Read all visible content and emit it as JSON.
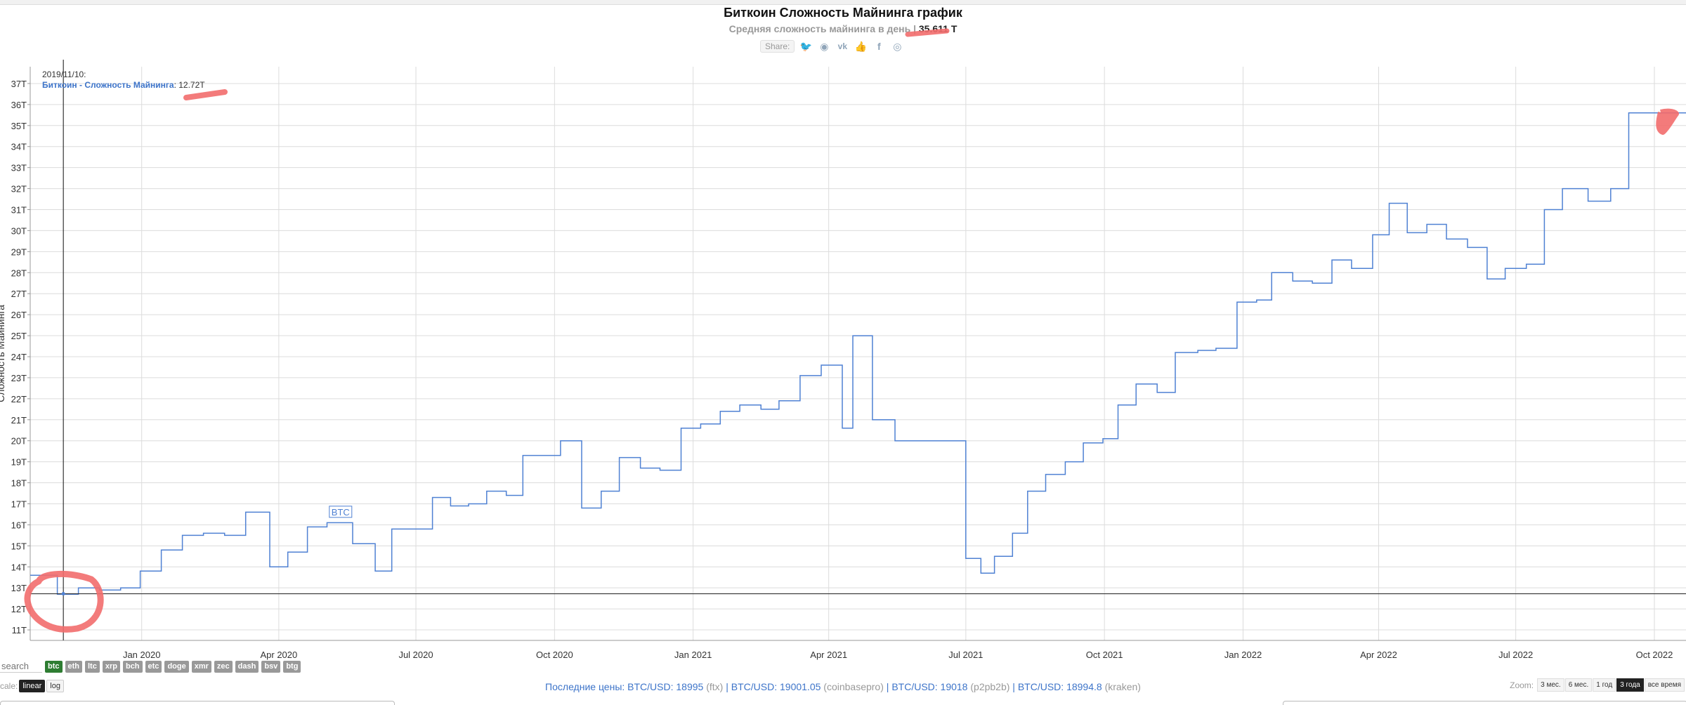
{
  "title": "Биткоин Сложность Майнинга график",
  "subtitle": {
    "label": "Средняя сложность майнинга в день | ",
    "value": "35.611 T"
  },
  "share": {
    "label": "Share:",
    "icons": [
      "twitter-icon",
      "reddit-icon",
      "vk-icon",
      "like-icon",
      "facebook-icon",
      "weibo-icon"
    ]
  },
  "tooltip": {
    "date": "2019/11/10:",
    "series": "Биткоин - Сложность Майнинга",
    "value": "12.72T"
  },
  "flag_label": "BTC",
  "coins": [
    "btc",
    "eth",
    "ltc",
    "xrp",
    "bch",
    "etc",
    "doge",
    "xmr",
    "zec",
    "dash",
    "bsv",
    "btg"
  ],
  "active_coin": "btc",
  "search_placeholder": "search",
  "scale": {
    "label": "cale:",
    "options": [
      "linear",
      "log"
    ],
    "active": "linear"
  },
  "prices": {
    "label": "Последние цены:",
    "items": [
      {
        "pair": "BTC/USD",
        "price": "18995",
        "exchange": "(ftx)"
      },
      {
        "pair": "BTC/USD",
        "price": "19001.05",
        "exchange": "(coinbasepro)"
      },
      {
        "pair": "BTC/USD",
        "price": "19018",
        "exchange": "(p2pb2b)"
      },
      {
        "pair": "BTC/USD",
        "price": "18994.8",
        "exchange": "(kraken)"
      }
    ]
  },
  "zoom": {
    "label": "Zoom:",
    "options": [
      "3 мес.",
      "6 мес.",
      "1 год",
      "3 года",
      "все время"
    ],
    "active": "3 года"
  },
  "colors": {
    "line": "#4f81d3",
    "grid": "#dcdcdc",
    "annotation": "#f26d6d",
    "axis": "#333333"
  },
  "chart_data": {
    "type": "line",
    "title": "Биткоин Сложность Майнинга график",
    "ylabel": "Сложность Майнинга",
    "y_unit": "T",
    "ylim": [
      10.5,
      37.8
    ],
    "xlim": [
      "2019-10-19",
      "2022-10-22"
    ],
    "y_ticks": [
      11,
      12,
      13,
      14,
      15,
      16,
      17,
      18,
      19,
      20,
      21,
      22,
      23,
      24,
      25,
      26,
      27,
      28,
      29,
      30,
      31,
      32,
      33,
      34,
      35,
      36,
      37
    ],
    "x_ticks": [
      {
        "date": "2020-01-01",
        "label": "Jan 2020"
      },
      {
        "date": "2020-04-01",
        "label": "Apr 2020"
      },
      {
        "date": "2020-07-01",
        "label": "Jul 2020"
      },
      {
        "date": "2020-10-01",
        "label": "Oct 2020"
      },
      {
        "date": "2021-01-01",
        "label": "Jan 2021"
      },
      {
        "date": "2021-04-01",
        "label": "Apr 2021"
      },
      {
        "date": "2021-07-01",
        "label": "Jul 2021"
      },
      {
        "date": "2021-10-01",
        "label": "Oct 2021"
      },
      {
        "date": "2022-01-01",
        "label": "Jan 2022"
      },
      {
        "date": "2022-04-01",
        "label": "Apr 2022"
      },
      {
        "date": "2022-07-01",
        "label": "Jul 2022"
      },
      {
        "date": "2022-10-01",
        "label": "Oct 2022"
      }
    ],
    "grid": true,
    "crosshair": {
      "date": "2019-11-10",
      "value": 12.72
    },
    "series": [
      {
        "name": "Биткоин - Сложность Майнинга",
        "points": [
          [
            "2019-10-19",
            13.6
          ],
          [
            "2019-11-03",
            13.6
          ],
          [
            "2019-11-06",
            12.7
          ],
          [
            "2019-11-20",
            13.0
          ],
          [
            "2019-12-04",
            12.9
          ],
          [
            "2019-12-18",
            13.0
          ],
          [
            "2019-12-31",
            13.8
          ],
          [
            "2020-01-14",
            14.8
          ],
          [
            "2020-01-28",
            15.5
          ],
          [
            "2020-02-11",
            15.6
          ],
          [
            "2020-02-25",
            15.5
          ],
          [
            "2020-03-10",
            16.6
          ],
          [
            "2020-03-26",
            14.0
          ],
          [
            "2020-04-07",
            14.7
          ],
          [
            "2020-04-20",
            15.9
          ],
          [
            "2020-05-03",
            16.1
          ],
          [
            "2020-05-20",
            15.1
          ],
          [
            "2020-06-04",
            13.8
          ],
          [
            "2020-06-15",
            15.8
          ],
          [
            "2020-06-30",
            15.8
          ],
          [
            "2020-07-12",
            17.3
          ],
          [
            "2020-07-24",
            16.9
          ],
          [
            "2020-08-05",
            17.0
          ],
          [
            "2020-08-17",
            17.6
          ],
          [
            "2020-08-30",
            17.4
          ],
          [
            "2020-09-10",
            19.3
          ],
          [
            "2020-09-24",
            19.3
          ],
          [
            "2020-10-05",
            20.0
          ],
          [
            "2020-10-19",
            16.8
          ],
          [
            "2020-11-01",
            17.6
          ],
          [
            "2020-11-13",
            19.2
          ],
          [
            "2020-11-27",
            18.7
          ],
          [
            "2020-12-10",
            18.6
          ],
          [
            "2020-12-24",
            20.6
          ],
          [
            "2021-01-06",
            20.8
          ],
          [
            "2021-01-19",
            21.4
          ],
          [
            "2021-02-01",
            21.7
          ],
          [
            "2021-02-15",
            21.5
          ],
          [
            "2021-02-27",
            21.9
          ],
          [
            "2021-03-13",
            23.1
          ],
          [
            "2021-03-27",
            23.6
          ],
          [
            "2021-04-10",
            20.6
          ],
          [
            "2021-04-17",
            25.0
          ],
          [
            "2021-04-30",
            21.0
          ],
          [
            "2021-05-15",
            20.0
          ],
          [
            "2021-07-01",
            14.4
          ],
          [
            "2021-07-11",
            13.7
          ],
          [
            "2021-07-20",
            14.5
          ],
          [
            "2021-08-01",
            15.6
          ],
          [
            "2021-08-11",
            17.6
          ],
          [
            "2021-08-23",
            18.4
          ],
          [
            "2021-09-05",
            19.0
          ],
          [
            "2021-09-17",
            19.9
          ],
          [
            "2021-09-30",
            20.1
          ],
          [
            "2021-10-10",
            21.7
          ],
          [
            "2021-10-22",
            22.7
          ],
          [
            "2021-11-05",
            22.3
          ],
          [
            "2021-11-17",
            24.2
          ],
          [
            "2021-12-02",
            24.3
          ],
          [
            "2021-12-14",
            24.4
          ],
          [
            "2021-12-28",
            26.6
          ],
          [
            "2022-01-10",
            26.7
          ],
          [
            "2022-01-20",
            28.0
          ],
          [
            "2022-02-03",
            27.6
          ],
          [
            "2022-02-16",
            27.5
          ],
          [
            "2022-03-01",
            28.6
          ],
          [
            "2022-03-14",
            28.2
          ],
          [
            "2022-03-28",
            29.8
          ],
          [
            "2022-04-08",
            31.3
          ],
          [
            "2022-04-20",
            29.9
          ],
          [
            "2022-05-03",
            30.3
          ],
          [
            "2022-05-16",
            29.6
          ],
          [
            "2022-05-30",
            29.2
          ],
          [
            "2022-06-12",
            27.7
          ],
          [
            "2022-06-24",
            28.2
          ],
          [
            "2022-07-08",
            28.4
          ],
          [
            "2022-07-20",
            31.0
          ],
          [
            "2022-08-01",
            32.0
          ],
          [
            "2022-08-18",
            31.4
          ],
          [
            "2022-09-02",
            32.0
          ],
          [
            "2022-09-14",
            35.6
          ],
          [
            "2022-10-22",
            35.6
          ]
        ]
      }
    ]
  }
}
